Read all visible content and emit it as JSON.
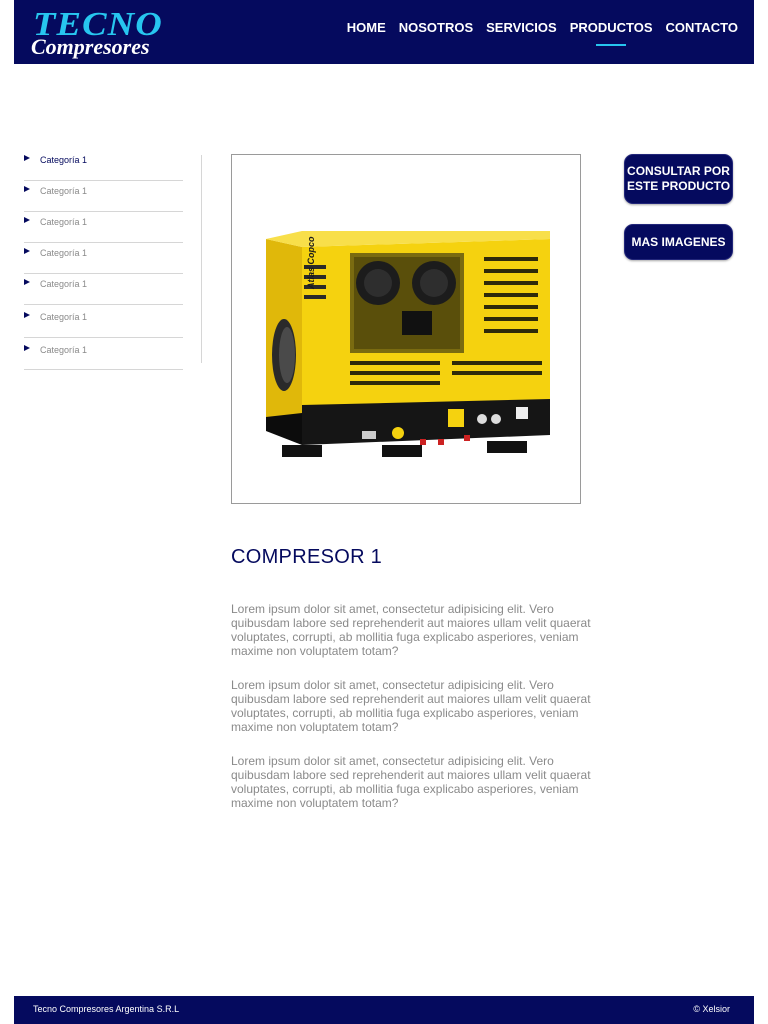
{
  "logo": {
    "line1": "TECNO",
    "line2": "Compresores"
  },
  "nav": {
    "items": [
      {
        "label": "HOME"
      },
      {
        "label": "NOSOTROS"
      },
      {
        "label": "SERVICIOS"
      },
      {
        "label": "PRODUCTOS",
        "active": true
      },
      {
        "label": "CONTACTO"
      }
    ]
  },
  "sidebar": {
    "items": [
      {
        "label": "Categoría 1",
        "active": true
      },
      {
        "label": "Categoría 1"
      },
      {
        "label": "Categoría 1"
      },
      {
        "label": "Categoría 1"
      },
      {
        "label": "Categoría 1"
      },
      {
        "label": "Categoría 1"
      },
      {
        "label": "Categoría 1"
      }
    ]
  },
  "actions": {
    "consultar": "CONSULTAR POR ESTE PRODUCTO",
    "imagenes": "MAS IMAGENES"
  },
  "product": {
    "title": "COMPRESOR 1",
    "image_badge": "Atlas Copco",
    "paragraphs": [
      "Lorem ipsum dolor sit amet, consectetur adipisicing elit. Vero quibusdam labore sed reprehenderit aut maiores ullam velit quaerat voluptates, corrupti, ab mollitia fuga explicabo asperiores, veniam maxime non voluptatem totam?",
      "Lorem ipsum dolor sit amet, consectetur adipisicing elit. Vero quibusdam labore sed reprehenderit aut maiores ullam velit quaerat voluptates, corrupti, ab mollitia fuga explicabo asperiores, veniam maxime non voluptatem totam?",
      "Lorem ipsum dolor sit amet, consectetur adipisicing elit. Vero quibusdam labore sed reprehenderit aut maiores ullam velit quaerat voluptates, corrupti, ab mollitia fuga explicabo asperiores, veniam maxime non voluptatem totam?"
    ]
  },
  "footer": {
    "company": "Tecno Compresores Argentina S.R.L",
    "credit": "© Xelsior"
  },
  "colors": {
    "primary": "#050a5e",
    "accent": "#27c6ef",
    "product_yellow": "#f5d20f"
  }
}
